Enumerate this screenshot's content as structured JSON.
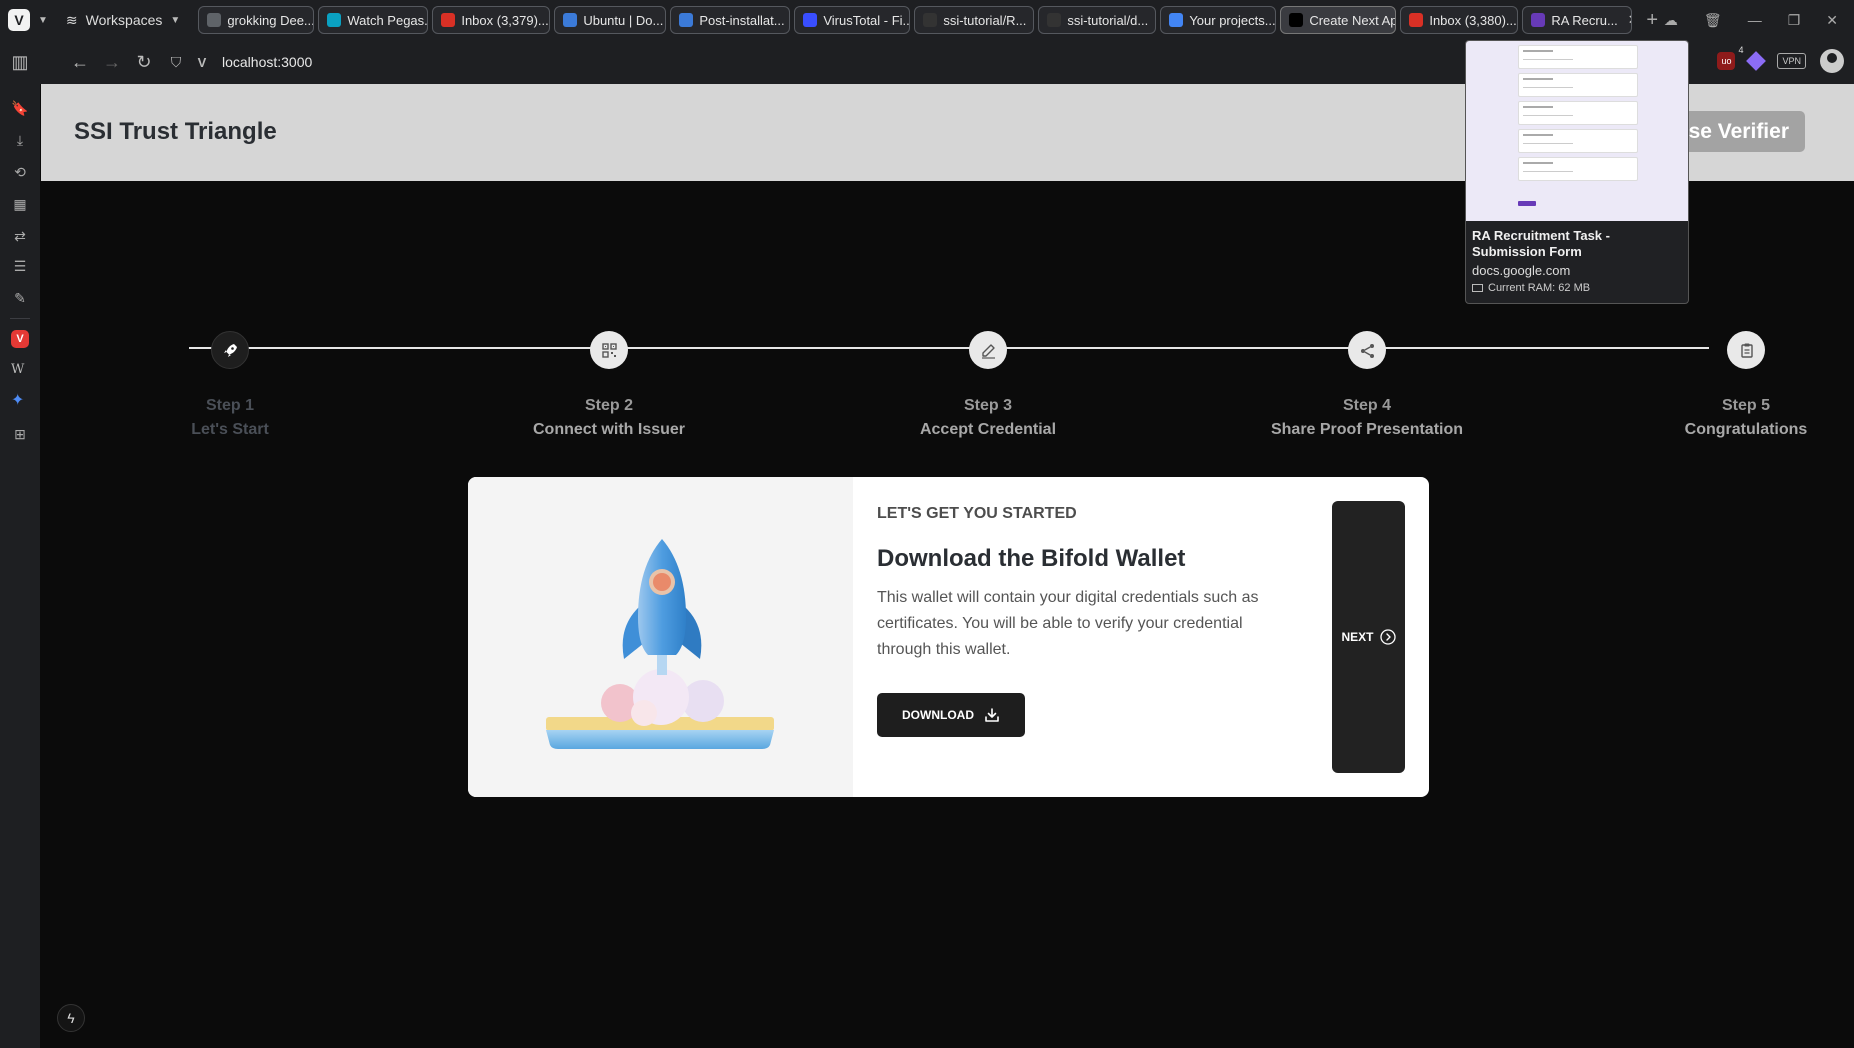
{
  "browser": {
    "workspaces_label": "Workspaces",
    "tabs": [
      {
        "label": "grokking Dee...",
        "icon": "document-icon",
        "color": "#5f6368"
      },
      {
        "label": "Watch Pegas...",
        "icon": "stream-site-icon",
        "color": "#0aa1c2"
      },
      {
        "label": "Inbox (3,379)...",
        "icon": "gmail-icon",
        "color": "#d93025"
      },
      {
        "label": "Ubuntu | Do...",
        "icon": "ubuntu-globe-icon",
        "color": "#3b7ad8"
      },
      {
        "label": "Post-installat...",
        "icon": "globe-icon",
        "color": "#3b7ad8"
      },
      {
        "label": "VirusTotal - Fi...",
        "icon": "virustotal-icon",
        "color": "#394eff"
      },
      {
        "label": "ssi-tutorial/R...",
        "icon": "github-icon",
        "color": "#333333"
      },
      {
        "label": "ssi-tutorial/d...",
        "icon": "github-icon",
        "color": "#333333"
      },
      {
        "label": "Your projects...",
        "icon": "google-icon",
        "color": "#4285f4"
      },
      {
        "label": "Create Next Ap",
        "icon": "vercel-icon",
        "color": "#000000",
        "active": true
      },
      {
        "label": "Inbox (3,380)...",
        "icon": "gmail-icon",
        "color": "#d93025"
      },
      {
        "label": "RA Recru...",
        "icon": "google-forms-icon",
        "color": "#673ab7",
        "closable": true
      }
    ],
    "url": "localhost:3000",
    "ublock_count": "4",
    "vpn_label": "VPN"
  },
  "tab_preview": {
    "title": "RA Recruitment Task - Submission Form",
    "domain": "docs.google.com",
    "ram": "Current RAM: 62 MB"
  },
  "app": {
    "title": "SSI Trust Triangle",
    "verifier_button": "Use Verifier",
    "steps": [
      {
        "number": "Step 1",
        "name": "Let's Start",
        "icon": "rocket-icon"
      },
      {
        "number": "Step 2",
        "name": "Connect with Issuer",
        "icon": "qr-code-icon"
      },
      {
        "number": "Step 3",
        "name": "Accept Credential",
        "icon": "edit-icon"
      },
      {
        "number": "Step 4",
        "name": "Share Proof Presentation",
        "icon": "share-icon"
      },
      {
        "number": "Step 5",
        "name": "Congratulations",
        "icon": "clipboard-icon"
      }
    ],
    "current_step": 1,
    "card": {
      "eyebrow": "LET'S GET YOU STARTED",
      "heading": "Download the Bifold Wallet",
      "description": "This wallet will contain your digital credentials such as certificates. You will be able to verify your credential through this wallet.",
      "download_label": "DOWNLOAD",
      "next_label": "NEXT"
    }
  }
}
